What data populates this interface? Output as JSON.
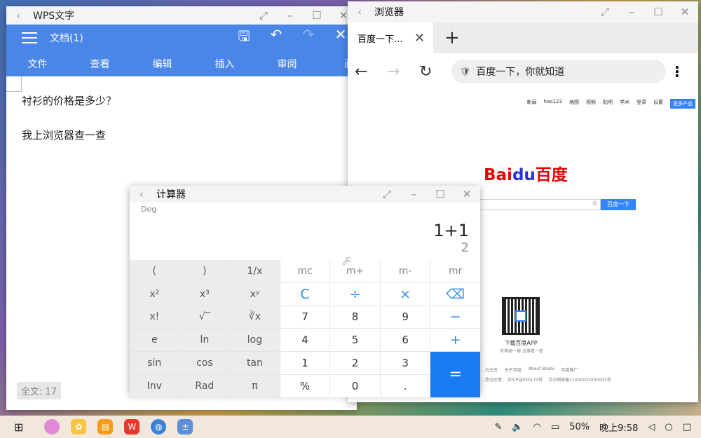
{
  "wps": {
    "title": "WPS文字",
    "doc_name": "文档(1)",
    "tabs": [
      "文件",
      "查看",
      "编辑",
      "插入",
      "审阅",
      "画"
    ],
    "lines": [
      "衬衫的价格是多少？",
      "我上浏览器查一查"
    ],
    "wordcount": "全文: 17"
  },
  "browser": {
    "title": "浏览器",
    "tab_label": "百度一下...",
    "address": "百度一下，你就知道",
    "top_links": [
      "新闻",
      "hao123",
      "地图",
      "视频",
      "贴吧",
      "学术",
      "登录",
      "设置"
    ],
    "more_products": "更多产品",
    "logo_left": "Bai",
    "logo_du": "du",
    "logo_right": "百度",
    "search_button": "百度一下",
    "app_title": "下载百度APP",
    "app_sub": "有事搜一搜 没事看一看",
    "footer_links": [
      "...为主页",
      "关于百度",
      "About Baidu",
      "百度推广"
    ],
    "footer_links2": [
      "...意见反馈",
      "京ICP证030173号",
      "京公网安备11000002000001号"
    ]
  },
  "calc": {
    "title": "计算器",
    "mode": "Deg",
    "expression": "1+1",
    "result": "2",
    "keys": [
      "(",
      ")",
      "1/x",
      "mc",
      "m+",
      "m-",
      "mr",
      "x²",
      "x³",
      "xʸ",
      "C",
      "÷",
      "×",
      "⌫",
      "x!",
      "√‾",
      "∛x",
      "7",
      "8",
      "9",
      "−",
      "e",
      "ln",
      "log",
      "4",
      "5",
      "6",
      "+",
      "sin",
      "cos",
      "tan",
      "1",
      "2",
      "3",
      "=",
      "Inv",
      "Rad",
      "π",
      "%",
      "0",
      "."
    ]
  },
  "taskbar": {
    "battery": "50%",
    "time": "晚上9:58"
  },
  "colors": {
    "wps_blue": "#4a86e8",
    "calc_accent": "#1a7cf2",
    "baidu_red": "#e10602",
    "baidu_blue": "#2932e1"
  }
}
